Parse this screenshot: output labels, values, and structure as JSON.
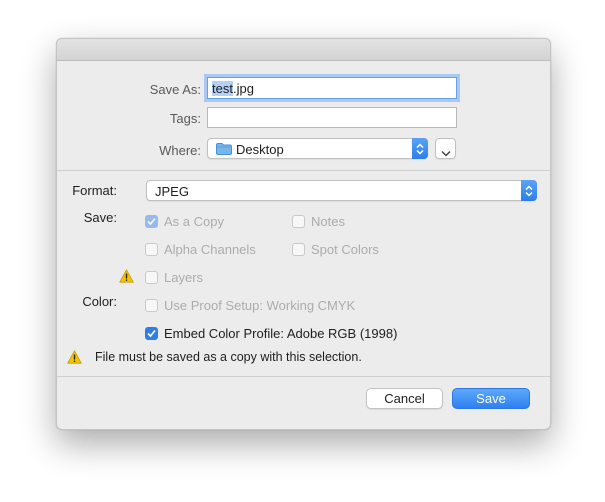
{
  "dialog": {
    "save_as_label": "Save As:",
    "filename_selected": "test",
    "filename_rest": ".jpg",
    "tags_label": "Tags:",
    "tags_value": "",
    "where_label": "Where:",
    "where_value": "Desktop",
    "format_label": "Format:",
    "format_value": "JPEG",
    "save_label": "Save:",
    "color_label": "Color:",
    "options": [
      {
        "label": "As a Copy",
        "checked": true,
        "enabled": false
      },
      {
        "label": "Notes",
        "checked": false,
        "enabled": false
      },
      {
        "label": "Alpha Channels",
        "checked": false,
        "enabled": false
      },
      {
        "label": "Spot Colors",
        "checked": false,
        "enabled": false
      },
      {
        "label": "Layers",
        "checked": false,
        "enabled": false
      },
      {
        "label": "Use Proof Setup:  Working CMYK",
        "checked": false,
        "enabled": false
      },
      {
        "label": "Embed Color Profile:  Adobe RGB (1998)",
        "checked": true,
        "enabled": true
      }
    ],
    "warning_text": "File must be saved as a copy with this selection.",
    "cancel_label": "Cancel",
    "save_button_label": "Save"
  },
  "icons": {
    "folder": "folder-icon",
    "warning": "warning-icon",
    "stepper": "updown-chevron-icon",
    "expand": "chevron-down-icon"
  },
  "colors": {
    "accent": "#2f7ee8",
    "focus_ring": "#a9c8f2",
    "warning": "#f5c400"
  }
}
